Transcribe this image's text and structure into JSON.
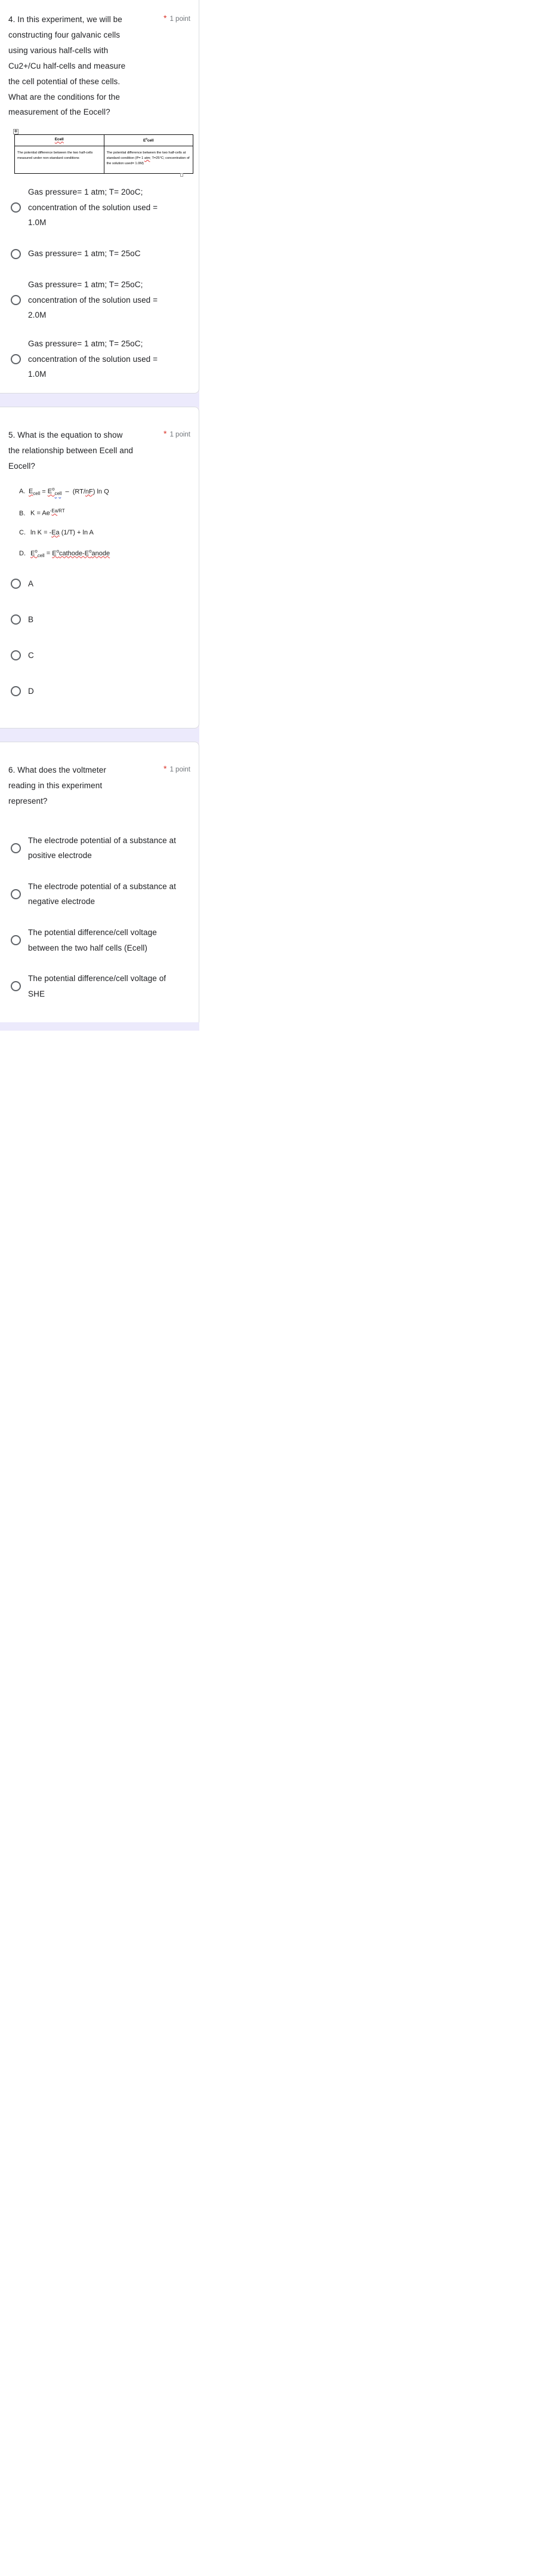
{
  "meta": {
    "accent_required_color": "#d93025",
    "card_background": "#ffffff",
    "page_background": "#f0ebf8",
    "text_color": "#202124",
    "muted_text_color": "#70757a"
  },
  "questions": [
    {
      "id": "q4",
      "title": "4. In this experiment, we will be constructing four galvanic cells using various half-cells with Cu2+/Cu half-cells and measure the cell potential of these cells. What are the conditions for the measurement of the Eocell?",
      "required_marker": "*",
      "points": "1 point",
      "embedded_image": {
        "type": "word-table",
        "move_handle_icon": "move-handle-icon",
        "headers": [
          "Ecell",
          "E°cell"
        ],
        "cells": [
          "The potential difference between the two half-cells measured under non-standard conditions",
          "The potential difference between the two half-cells at standard condition (P= 1 atm; T=25°C; concentration of the solution used= 1.0M)"
        ]
      },
      "options": [
        "Gas pressure= 1 atm; T= 20oC; concentration of the solution used = 1.0M",
        "Gas pressure= 1 atm; T= 25oC",
        "Gas pressure= 1 atm; T= 25oC; concentration of the solution used = 2.0M",
        "Gas pressure= 1 atm; T= 25oC; concentration of the solution used = 1.0M"
      ]
    },
    {
      "id": "q5",
      "title": "5. What is the equation to show the relationship between Ecell and Eocell?",
      "required_marker": "*",
      "points": "1 point",
      "embedded_image": {
        "type": "equation-list",
        "lines": [
          "A.  Ecell = E°cell  –  (RT/nF) ln Q",
          "B.  K = Ae-Ea/RT",
          "C.  ln K = -Ea (1/T) + ln A",
          "D.  E°cell = E°cathode-E°anode"
        ]
      },
      "options": [
        "A",
        "B",
        "C",
        "D"
      ]
    },
    {
      "id": "q6",
      "title": "6.  What does the voltmeter reading in this experiment represent?",
      "required_marker": "*",
      "points": "1 point",
      "options": [
        "The electrode potential of a substance at positive electrode",
        "The electrode potential of a substance at negative electrode",
        "The potential difference/cell voltage between the two half cells (Ecell)",
        "The potential difference/cell voltage of SHE"
      ]
    }
  ]
}
